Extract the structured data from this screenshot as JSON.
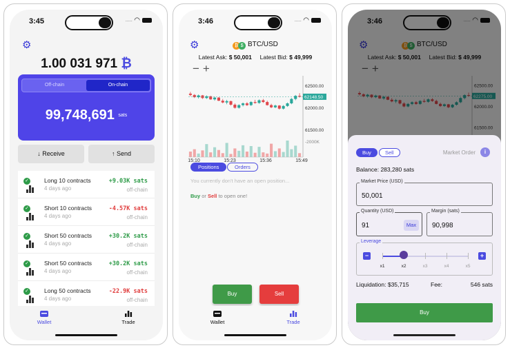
{
  "colors": {
    "accent": "#4b4be0",
    "card": "#4f44e8",
    "green": "#2e9b48",
    "red": "#e03c3c",
    "bitcoin": "#f39a1e"
  },
  "wallet_screen": {
    "status_time": "3:45",
    "balance_value": "1.00 031 971",
    "balance_unit": "₿",
    "segment": {
      "off": "Off-chain",
      "on": "On-chain"
    },
    "sats_value": "99,748,691",
    "sats_unit": "sats",
    "receive_label": "Receive",
    "send_label": "Send",
    "transactions": [
      {
        "name": "Long 10 contracts",
        "ago": "4 days ago",
        "amount": "+9.03K sats",
        "chain": "off-chain",
        "sign": "pos"
      },
      {
        "name": "Short 10 contracts",
        "ago": "4 days ago",
        "amount": "-4.57K sats",
        "chain": "off-chain",
        "sign": "neg"
      },
      {
        "name": "Short 50 contracts",
        "ago": "4 days ago",
        "amount": "+30.2K sats",
        "chain": "off-chain",
        "sign": "pos"
      },
      {
        "name": "Short 50 contracts",
        "ago": "4 days ago",
        "amount": "+30.2K sats",
        "chain": "off-chain",
        "sign": "pos"
      },
      {
        "name": "Long 50 contracts",
        "ago": "4 days ago",
        "amount": "-22.9K sats",
        "chain": "off-chain",
        "sign": "neg"
      }
    ],
    "tabs": {
      "wallet": "Wallet",
      "trade": "Trade"
    }
  },
  "trade_screen": {
    "status_time": "3:46",
    "pair": "BTC/USD",
    "coin_b": "₿",
    "coin_u": "$",
    "ask_label": "Latest Ask:",
    "ask_value": "$ 50,001",
    "bid_label": "Latest Bid:",
    "bid_value": "$ 49,999",
    "zoom": "−+",
    "tab_positions": "Positions",
    "tab_orders": "Orders",
    "no_position": "You currently don't have an open position...",
    "tip_buy": "Buy",
    "tip_or": "or",
    "tip_sell": "Sell",
    "tip_rest": "to open one!",
    "buy_label": "Buy",
    "sell_label": "Sell",
    "tabs": {
      "wallet": "Wallet",
      "trade": "Trade"
    }
  },
  "chart_data": {
    "type": "candlestick",
    "price_ticks": [
      "62500.00",
      "62000.00",
      "61500.00"
    ],
    "current_price_tag": "62148.50",
    "current_price_tag_alt": "62275.00",
    "volume_tick": "2000K",
    "time_ticks": [
      "15:10",
      "15:23",
      "15:36",
      "15:49"
    ],
    "y_range": [
      61350,
      62600
    ],
    "candles": [
      [
        62320,
        62360,
        62260,
        62290
      ],
      [
        62290,
        62310,
        62220,
        62240
      ],
      [
        62240,
        62300,
        62210,
        62280
      ],
      [
        62280,
        62290,
        62200,
        62220
      ],
      [
        62220,
        62280,
        62200,
        62260
      ],
      [
        62260,
        62270,
        62180,
        62190
      ],
      [
        62190,
        62250,
        62160,
        62230
      ],
      [
        62230,
        62240,
        62150,
        62160
      ],
      [
        62160,
        62200,
        62100,
        62120
      ],
      [
        62120,
        62180,
        62080,
        62150
      ],
      [
        62150,
        62160,
        62050,
        62070
      ],
      [
        62070,
        62100,
        61980,
        62000
      ],
      [
        62000,
        62080,
        61980,
        62060
      ],
      [
        62060,
        62120,
        62030,
        62100
      ],
      [
        62100,
        62130,
        62040,
        62060
      ],
      [
        62060,
        62150,
        62040,
        62130
      ],
      [
        62130,
        62180,
        62090,
        62110
      ],
      [
        62110,
        62190,
        62090,
        62170
      ],
      [
        62170,
        62200,
        62110,
        62130
      ],
      [
        62130,
        62160,
        62050,
        62060
      ],
      [
        62060,
        62090,
        61990,
        62010
      ],
      [
        62010,
        62070,
        61990,
        62050
      ],
      [
        62050,
        62060,
        61960,
        61980
      ],
      [
        61980,
        62060,
        61960,
        62040
      ],
      [
        62040,
        62120,
        62020,
        62100
      ],
      [
        62100,
        62220,
        62080,
        62200
      ],
      [
        62200,
        62290,
        62170,
        62270
      ],
      [
        62270,
        62330,
        62230,
        62250
      ]
    ],
    "volumes": [
      14,
      20,
      9,
      17,
      33,
      12,
      25,
      18,
      10,
      36,
      8,
      22,
      16,
      30,
      14,
      28,
      11,
      26,
      12,
      9,
      34,
      15,
      22,
      13,
      42,
      20,
      29,
      10
    ]
  },
  "order_sheet": {
    "status_time": "3:46",
    "buy_toggle": "Buy",
    "sell_toggle": "Sell",
    "order_type": "Market Order",
    "info_icon": "i",
    "balance_line": "Balance: 283,280 sats",
    "market_price_label": "Market Price (USD)",
    "market_price_value": "50,001",
    "quantity_label": "Quantity (USD)",
    "quantity_value": "91",
    "max_label": "Max",
    "margin_label": "Margin (sats)",
    "margin_value": "90,998",
    "leverage_label": "Leverage",
    "leverage_minus": "−",
    "leverage_plus": "+",
    "leverage_options": [
      "x1",
      "x2",
      "x3",
      "x4",
      "x5"
    ],
    "leverage_selected": 2,
    "liquidation_line": "Liquidation: $35,715",
    "fee_label": "Fee:",
    "fee_value": "546 sats",
    "buy_button": "Buy"
  }
}
